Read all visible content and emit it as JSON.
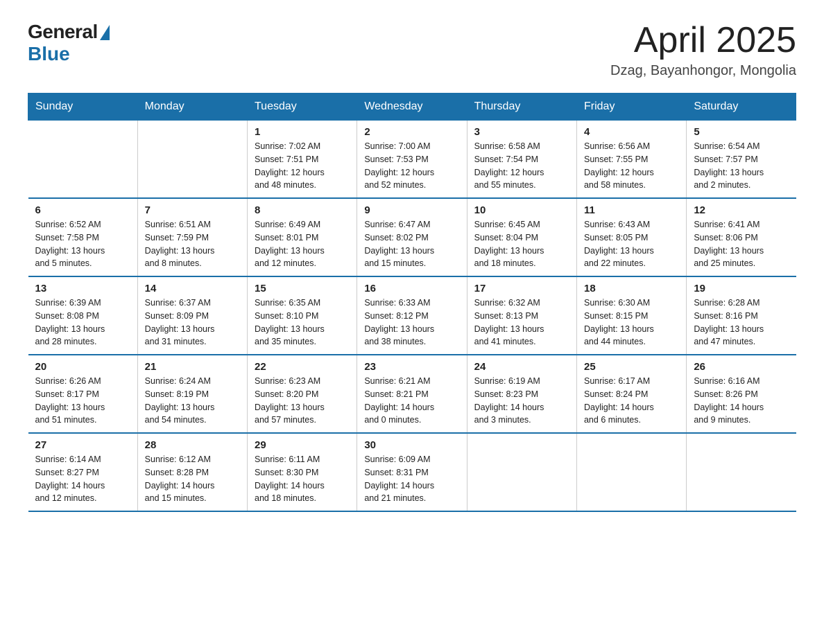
{
  "logo": {
    "general": "General",
    "blue": "Blue"
  },
  "title": "April 2025",
  "location": "Dzag, Bayanhongor, Mongolia",
  "days_header": [
    "Sunday",
    "Monday",
    "Tuesday",
    "Wednesday",
    "Thursday",
    "Friday",
    "Saturday"
  ],
  "weeks": [
    [
      {
        "day": "",
        "info": ""
      },
      {
        "day": "",
        "info": ""
      },
      {
        "day": "1",
        "info": "Sunrise: 7:02 AM\nSunset: 7:51 PM\nDaylight: 12 hours\nand 48 minutes."
      },
      {
        "day": "2",
        "info": "Sunrise: 7:00 AM\nSunset: 7:53 PM\nDaylight: 12 hours\nand 52 minutes."
      },
      {
        "day": "3",
        "info": "Sunrise: 6:58 AM\nSunset: 7:54 PM\nDaylight: 12 hours\nand 55 minutes."
      },
      {
        "day": "4",
        "info": "Sunrise: 6:56 AM\nSunset: 7:55 PM\nDaylight: 12 hours\nand 58 minutes."
      },
      {
        "day": "5",
        "info": "Sunrise: 6:54 AM\nSunset: 7:57 PM\nDaylight: 13 hours\nand 2 minutes."
      }
    ],
    [
      {
        "day": "6",
        "info": "Sunrise: 6:52 AM\nSunset: 7:58 PM\nDaylight: 13 hours\nand 5 minutes."
      },
      {
        "day": "7",
        "info": "Sunrise: 6:51 AM\nSunset: 7:59 PM\nDaylight: 13 hours\nand 8 minutes."
      },
      {
        "day": "8",
        "info": "Sunrise: 6:49 AM\nSunset: 8:01 PM\nDaylight: 13 hours\nand 12 minutes."
      },
      {
        "day": "9",
        "info": "Sunrise: 6:47 AM\nSunset: 8:02 PM\nDaylight: 13 hours\nand 15 minutes."
      },
      {
        "day": "10",
        "info": "Sunrise: 6:45 AM\nSunset: 8:04 PM\nDaylight: 13 hours\nand 18 minutes."
      },
      {
        "day": "11",
        "info": "Sunrise: 6:43 AM\nSunset: 8:05 PM\nDaylight: 13 hours\nand 22 minutes."
      },
      {
        "day": "12",
        "info": "Sunrise: 6:41 AM\nSunset: 8:06 PM\nDaylight: 13 hours\nand 25 minutes."
      }
    ],
    [
      {
        "day": "13",
        "info": "Sunrise: 6:39 AM\nSunset: 8:08 PM\nDaylight: 13 hours\nand 28 minutes."
      },
      {
        "day": "14",
        "info": "Sunrise: 6:37 AM\nSunset: 8:09 PM\nDaylight: 13 hours\nand 31 minutes."
      },
      {
        "day": "15",
        "info": "Sunrise: 6:35 AM\nSunset: 8:10 PM\nDaylight: 13 hours\nand 35 minutes."
      },
      {
        "day": "16",
        "info": "Sunrise: 6:33 AM\nSunset: 8:12 PM\nDaylight: 13 hours\nand 38 minutes."
      },
      {
        "day": "17",
        "info": "Sunrise: 6:32 AM\nSunset: 8:13 PM\nDaylight: 13 hours\nand 41 minutes."
      },
      {
        "day": "18",
        "info": "Sunrise: 6:30 AM\nSunset: 8:15 PM\nDaylight: 13 hours\nand 44 minutes."
      },
      {
        "day": "19",
        "info": "Sunrise: 6:28 AM\nSunset: 8:16 PM\nDaylight: 13 hours\nand 47 minutes."
      }
    ],
    [
      {
        "day": "20",
        "info": "Sunrise: 6:26 AM\nSunset: 8:17 PM\nDaylight: 13 hours\nand 51 minutes."
      },
      {
        "day": "21",
        "info": "Sunrise: 6:24 AM\nSunset: 8:19 PM\nDaylight: 13 hours\nand 54 minutes."
      },
      {
        "day": "22",
        "info": "Sunrise: 6:23 AM\nSunset: 8:20 PM\nDaylight: 13 hours\nand 57 minutes."
      },
      {
        "day": "23",
        "info": "Sunrise: 6:21 AM\nSunset: 8:21 PM\nDaylight: 14 hours\nand 0 minutes."
      },
      {
        "day": "24",
        "info": "Sunrise: 6:19 AM\nSunset: 8:23 PM\nDaylight: 14 hours\nand 3 minutes."
      },
      {
        "day": "25",
        "info": "Sunrise: 6:17 AM\nSunset: 8:24 PM\nDaylight: 14 hours\nand 6 minutes."
      },
      {
        "day": "26",
        "info": "Sunrise: 6:16 AM\nSunset: 8:26 PM\nDaylight: 14 hours\nand 9 minutes."
      }
    ],
    [
      {
        "day": "27",
        "info": "Sunrise: 6:14 AM\nSunset: 8:27 PM\nDaylight: 14 hours\nand 12 minutes."
      },
      {
        "day": "28",
        "info": "Sunrise: 6:12 AM\nSunset: 8:28 PM\nDaylight: 14 hours\nand 15 minutes."
      },
      {
        "day": "29",
        "info": "Sunrise: 6:11 AM\nSunset: 8:30 PM\nDaylight: 14 hours\nand 18 minutes."
      },
      {
        "day": "30",
        "info": "Sunrise: 6:09 AM\nSunset: 8:31 PM\nDaylight: 14 hours\nand 21 minutes."
      },
      {
        "day": "",
        "info": ""
      },
      {
        "day": "",
        "info": ""
      },
      {
        "day": "",
        "info": ""
      }
    ]
  ]
}
